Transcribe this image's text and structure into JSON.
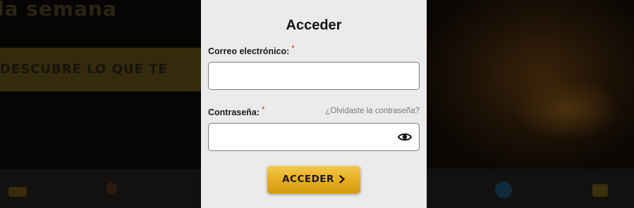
{
  "background": {
    "headline": "la semana",
    "banner_text": "DESCUBRE LO QUE TE"
  },
  "login": {
    "title": "Acceder",
    "email_label": "Correo electrónico:",
    "email_required_mark": "*",
    "email_value": "",
    "password_label": "Contraseña:",
    "password_required_mark": "*",
    "password_value": "",
    "forgot_link": "¿Olvidaste la contraseña?",
    "show_password_icon": "eye-icon",
    "submit_label": "ACCEDER",
    "submit_icon": "chevron-right-icon"
  },
  "colors": {
    "panel_bg": "#ebebeb",
    "button_gold": "#e7ae22",
    "required_red": "#d21e1e",
    "link_gray": "#7a7a7a"
  }
}
